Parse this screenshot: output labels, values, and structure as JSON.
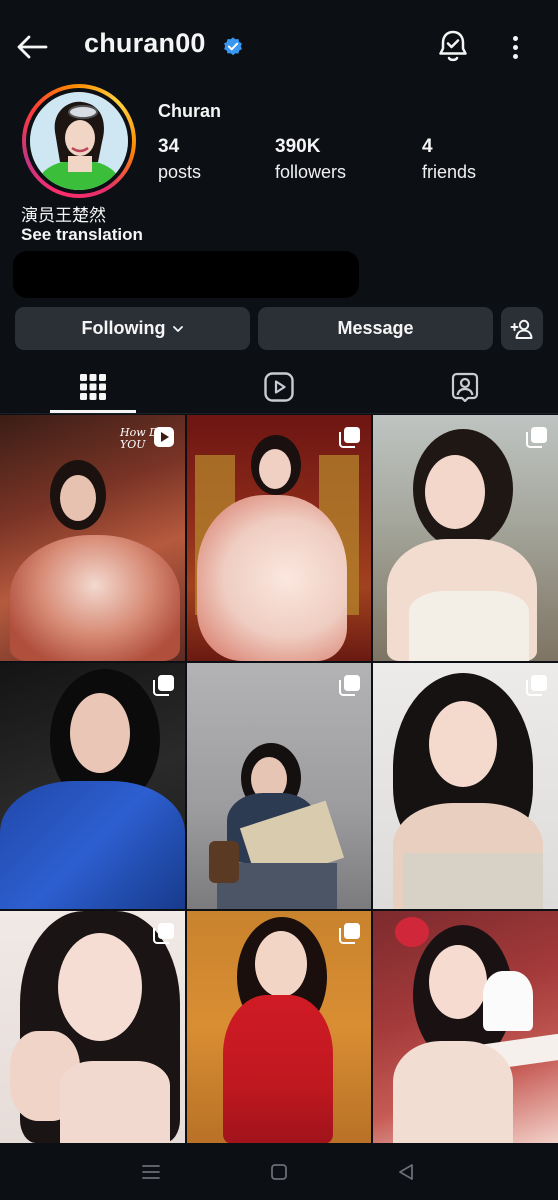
{
  "header": {
    "username": "churan00",
    "back_icon": "arrow-left-icon",
    "verified_icon": "verified-badge-icon",
    "notification_icon": "bell-check-icon",
    "more_icon": "more-vertical-icon"
  },
  "profile": {
    "display_name": "Churan",
    "bio": "演员王楚然",
    "see_translation": "See translation",
    "stats": [
      {
        "value": "34",
        "label": "posts"
      },
      {
        "value": "390K",
        "label": "followers"
      },
      {
        "value": "4",
        "label": "friends"
      }
    ]
  },
  "actions": {
    "following_label": "Following",
    "message_label": "Message",
    "add_user_icon": "person-add-icon"
  },
  "tabs": [
    {
      "name": "grid",
      "icon": "grid-icon",
      "active": true
    },
    {
      "name": "reels",
      "icon": "reels-icon",
      "active": false
    },
    {
      "name": "tagged",
      "icon": "tagged-person-icon",
      "active": false
    }
  ],
  "posts": [
    {
      "overlay_text": "How Do\nYOU",
      "multi": false,
      "reel": true
    },
    {
      "overlay_text": "",
      "multi": true
    },
    {
      "overlay_text": "",
      "multi": true
    },
    {
      "overlay_text": "",
      "multi": true
    },
    {
      "overlay_text": "",
      "multi": true
    },
    {
      "overlay_text": "",
      "multi": true
    },
    {
      "overlay_text": "",
      "multi": true
    },
    {
      "overlay_text": "",
      "multi": true
    },
    {
      "overlay_text": "",
      "multi": false
    }
  ],
  "colors": {
    "background": "#0c0f14",
    "button": "#2b3036",
    "verified": "#3897f0",
    "text": "#f5f5f5"
  },
  "navbar": {
    "menu_icon": "menu-icon",
    "home_icon": "square-home-icon",
    "back_icon": "triangle-back-icon"
  }
}
